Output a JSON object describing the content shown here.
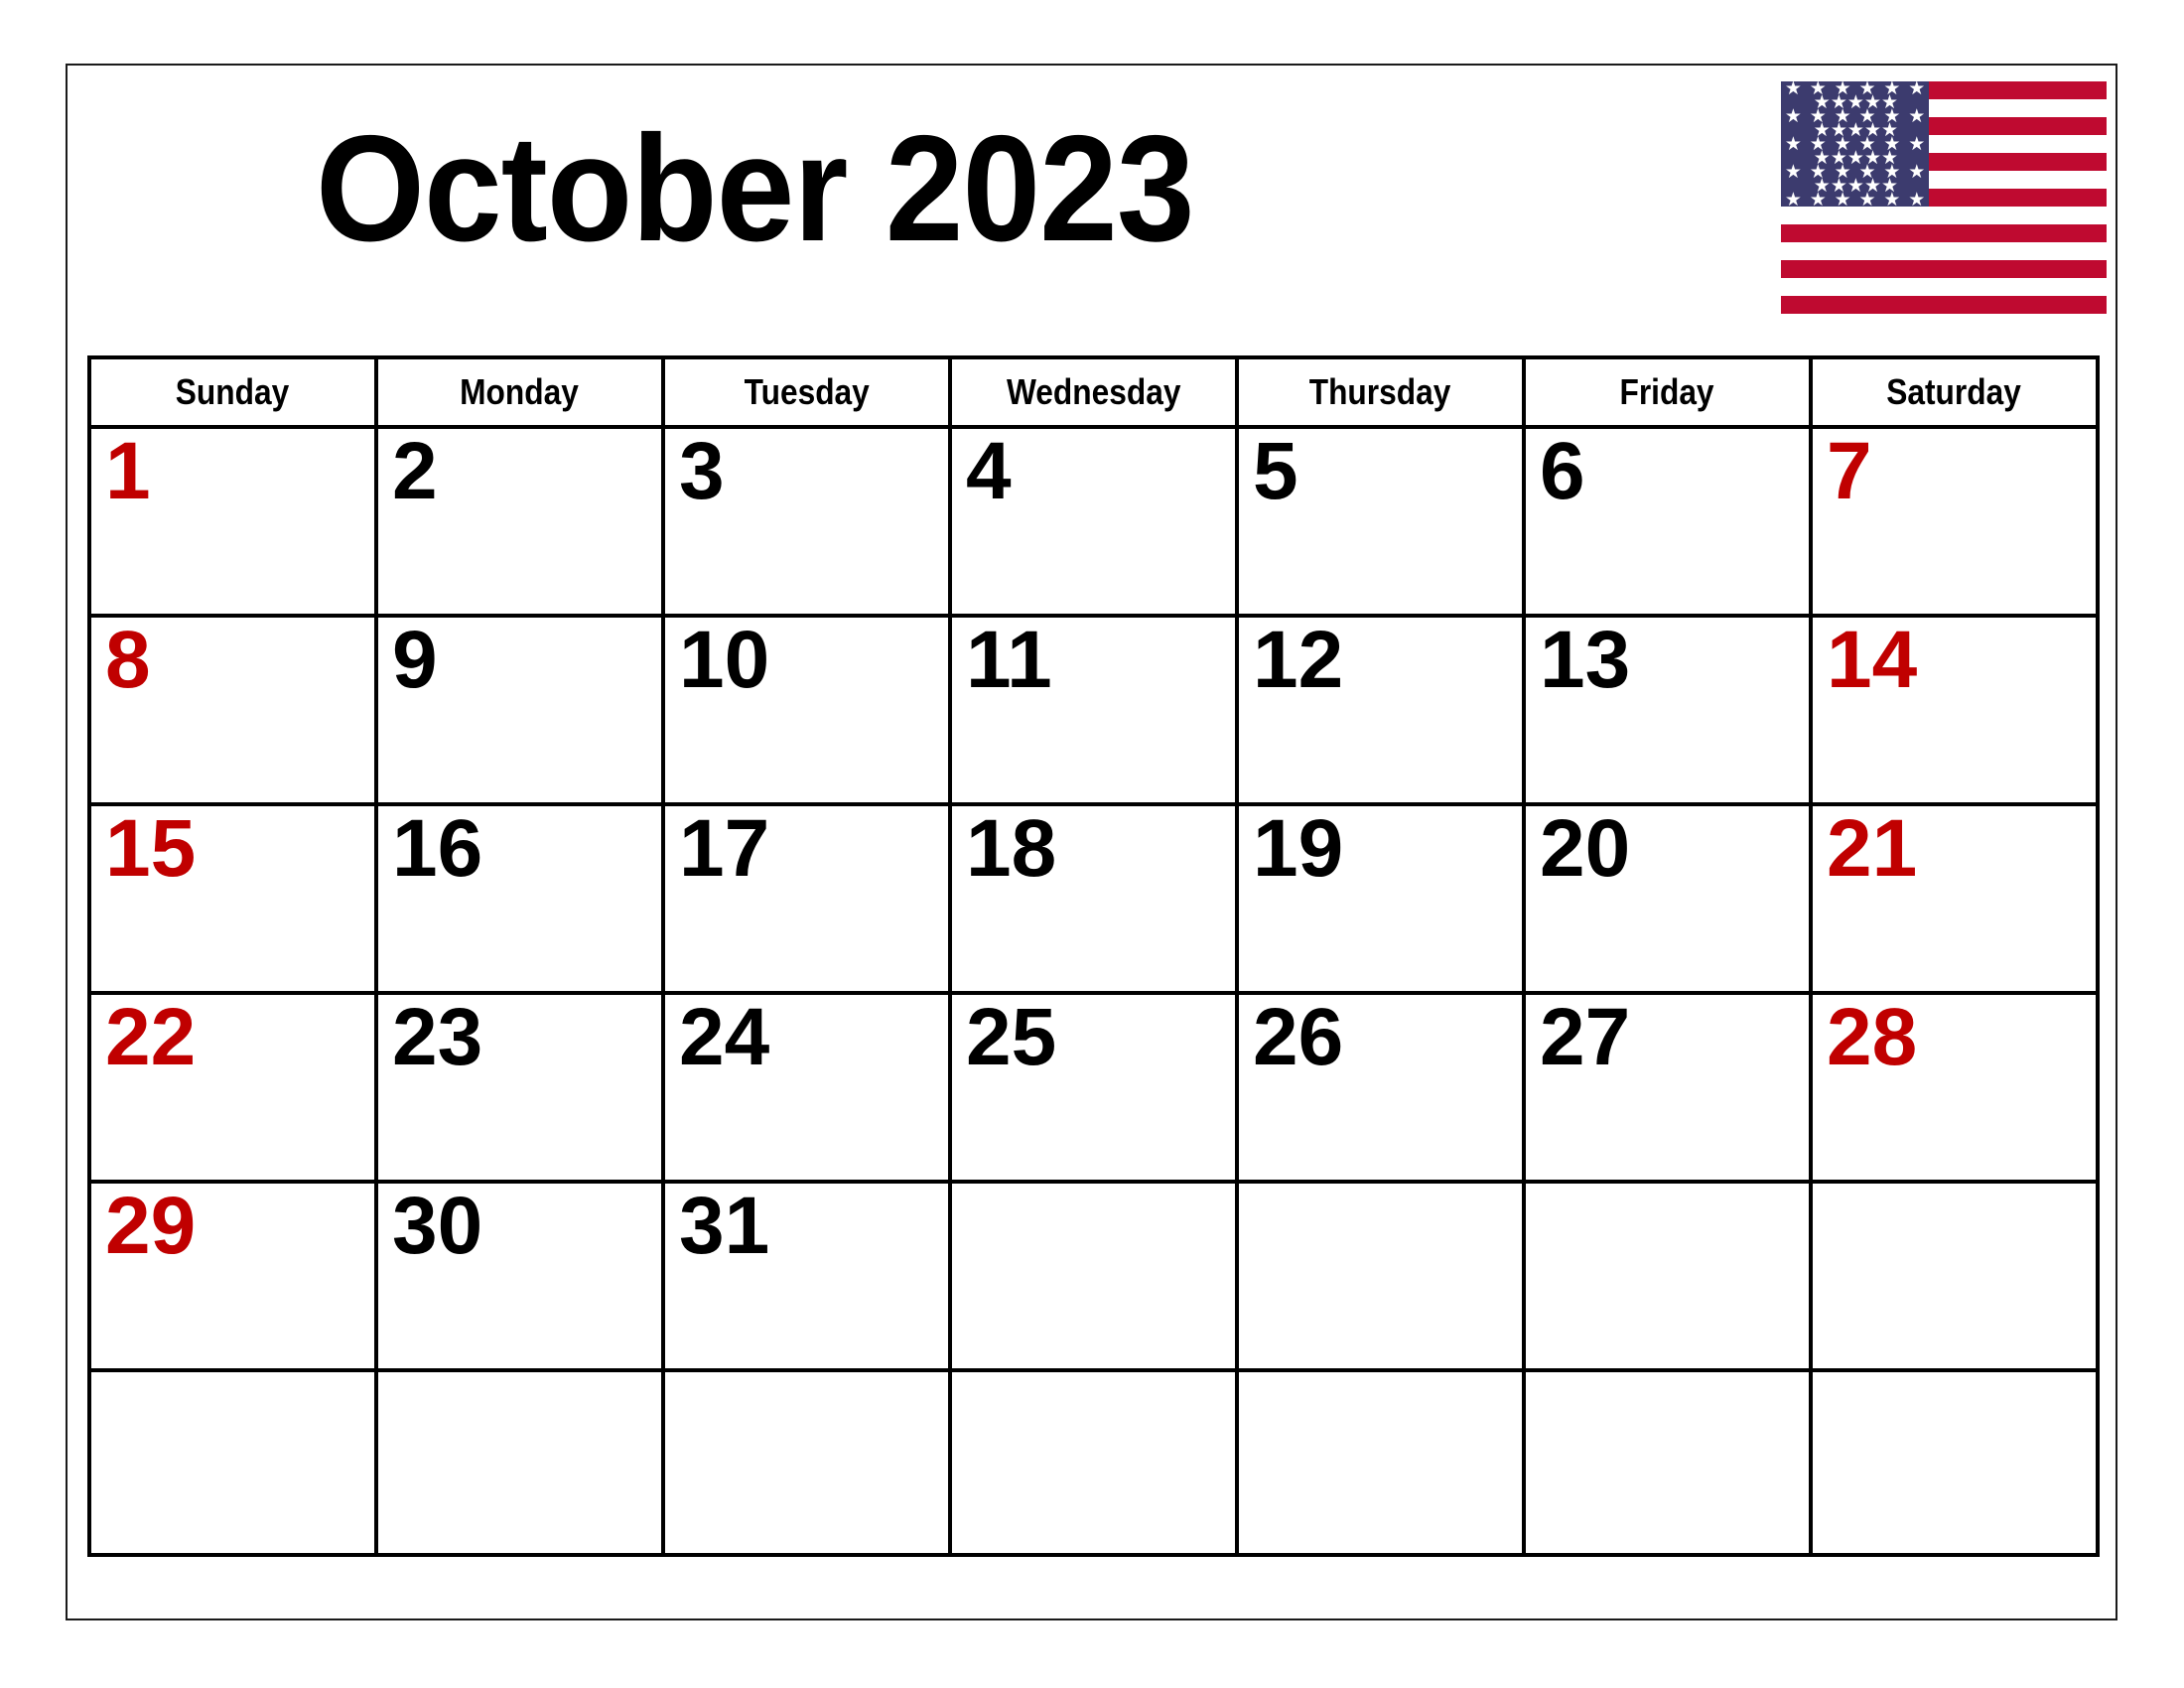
{
  "header": {
    "title": "October 2023",
    "month": "October",
    "year": "2023"
  },
  "flag": {
    "name": "united-states-flag",
    "canton_color": "#3c3b6e",
    "stripe_red": "#bf0a30",
    "stripe_white": "#ffffff",
    "star_glyph": "★",
    "star_rows": [
      6,
      5,
      6,
      5,
      6,
      5,
      6,
      5,
      6
    ],
    "stripe_count": 13
  },
  "colors": {
    "weekend": "#c00000",
    "weekday": "#000000",
    "border": "#000000",
    "page_border": "#1b1b1b",
    "background": "#ffffff"
  },
  "calendar": {
    "weekdays": [
      "Sunday",
      "Monday",
      "Tuesday",
      "Wednesday",
      "Thursday",
      "Friday",
      "Saturday"
    ],
    "weeks": [
      [
        {
          "day": "1",
          "weekend": true
        },
        {
          "day": "2",
          "weekend": false
        },
        {
          "day": "3",
          "weekend": false
        },
        {
          "day": "4",
          "weekend": false
        },
        {
          "day": "5",
          "weekend": false
        },
        {
          "day": "6",
          "weekend": false
        },
        {
          "day": "7",
          "weekend": true
        }
      ],
      [
        {
          "day": "8",
          "weekend": true
        },
        {
          "day": "9",
          "weekend": false
        },
        {
          "day": "10",
          "weekend": false
        },
        {
          "day": "11",
          "weekend": false
        },
        {
          "day": "12",
          "weekend": false
        },
        {
          "day": "13",
          "weekend": false
        },
        {
          "day": "14",
          "weekend": true
        }
      ],
      [
        {
          "day": "15",
          "weekend": true
        },
        {
          "day": "16",
          "weekend": false
        },
        {
          "day": "17",
          "weekend": false
        },
        {
          "day": "18",
          "weekend": false
        },
        {
          "day": "19",
          "weekend": false
        },
        {
          "day": "20",
          "weekend": false
        },
        {
          "day": "21",
          "weekend": true
        }
      ],
      [
        {
          "day": "22",
          "weekend": true
        },
        {
          "day": "23",
          "weekend": false
        },
        {
          "day": "24",
          "weekend": false
        },
        {
          "day": "25",
          "weekend": false
        },
        {
          "day": "26",
          "weekend": false
        },
        {
          "day": "27",
          "weekend": false
        },
        {
          "day": "28",
          "weekend": true
        }
      ],
      [
        {
          "day": "29",
          "weekend": true
        },
        {
          "day": "30",
          "weekend": false
        },
        {
          "day": "31",
          "weekend": false
        },
        {
          "day": "",
          "weekend": false
        },
        {
          "day": "",
          "weekend": false
        },
        {
          "day": "",
          "weekend": false
        },
        {
          "day": "",
          "weekend": true
        }
      ],
      [
        {
          "day": "",
          "weekend": true
        },
        {
          "day": "",
          "weekend": false
        },
        {
          "day": "",
          "weekend": false
        },
        {
          "day": "",
          "weekend": false
        },
        {
          "day": "",
          "weekend": false
        },
        {
          "day": "",
          "weekend": false
        },
        {
          "day": "",
          "weekend": true
        }
      ]
    ]
  }
}
